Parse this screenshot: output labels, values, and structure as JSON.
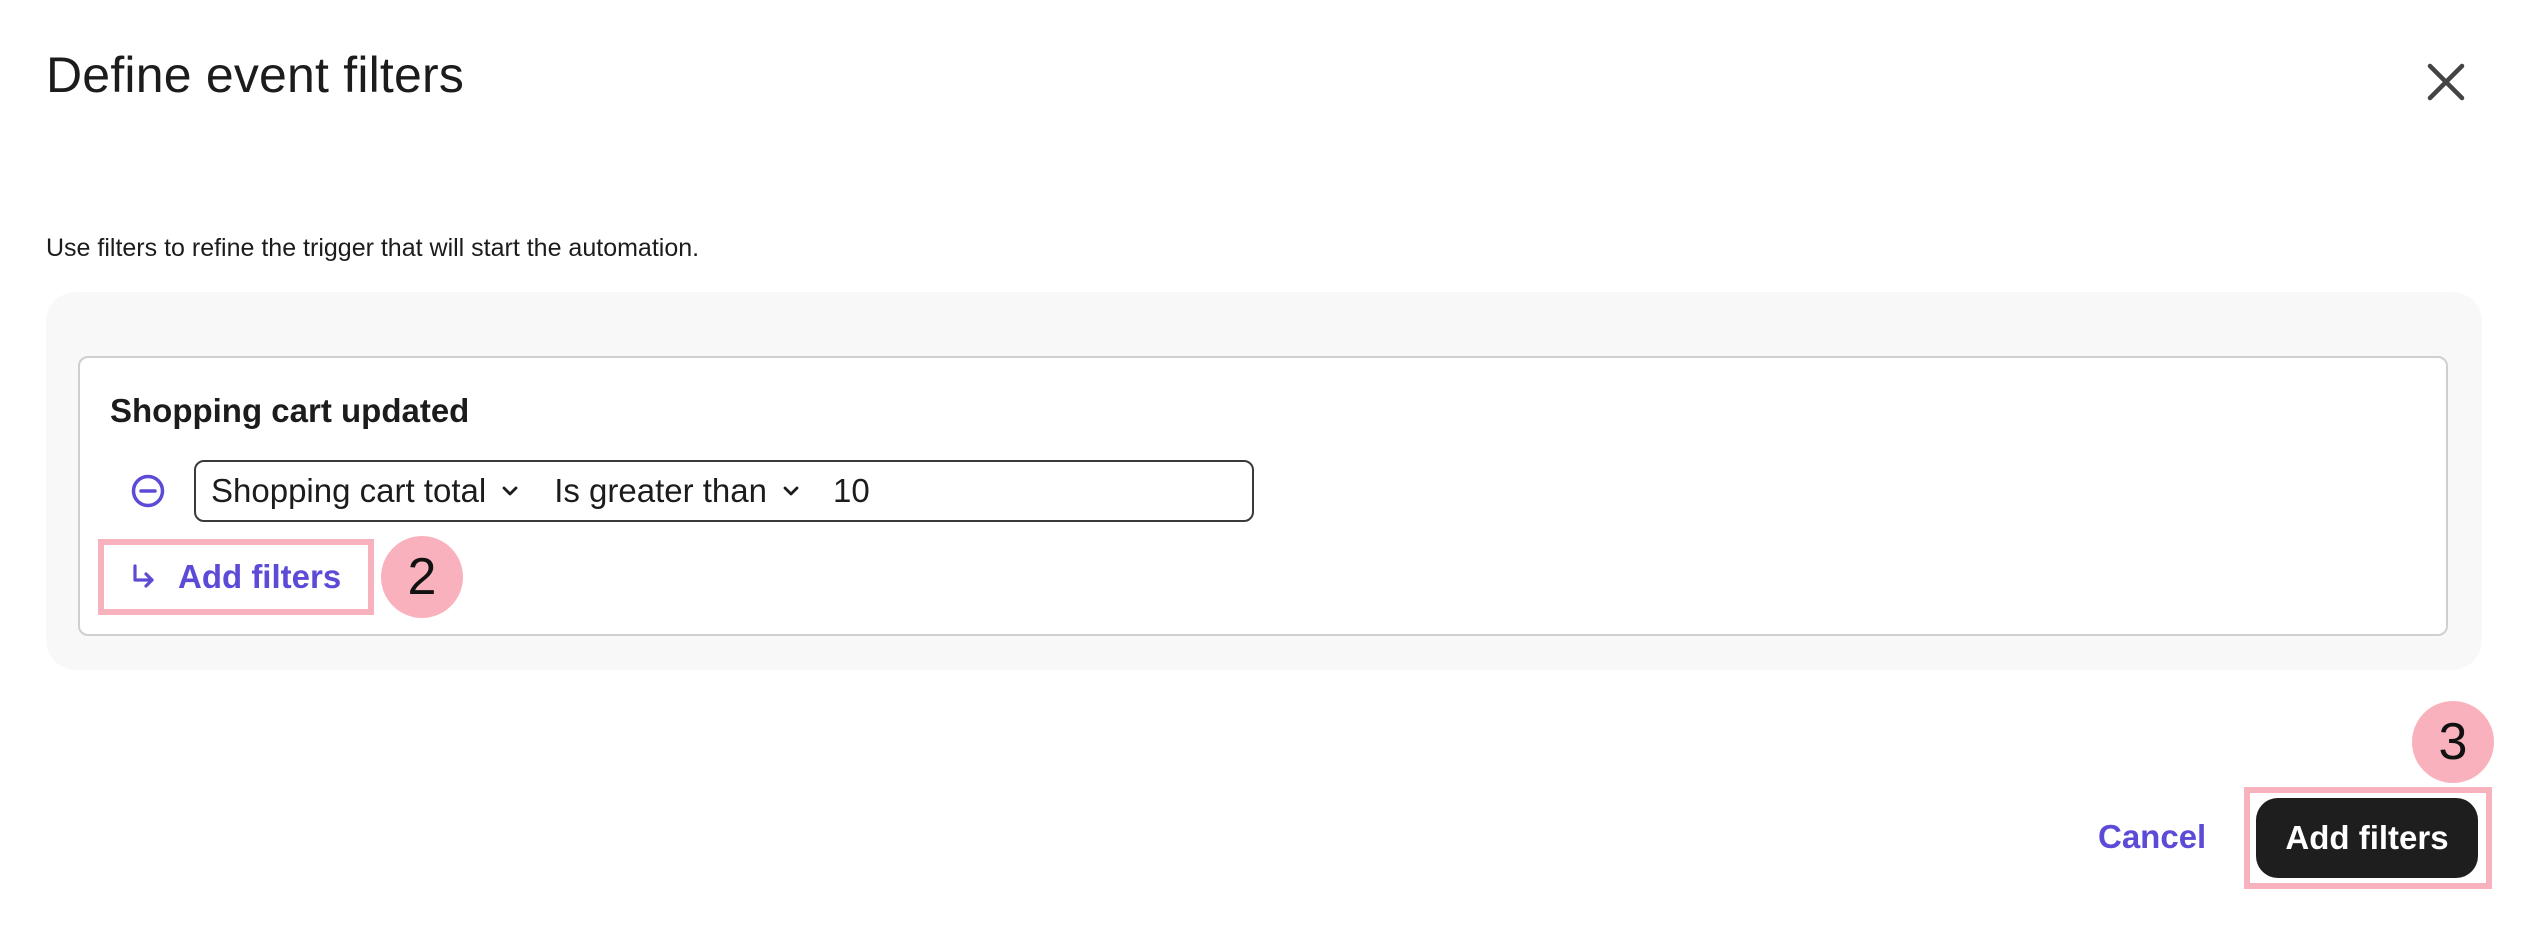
{
  "dialog": {
    "title": "Define event filters",
    "subtitle": "Use filters to refine the trigger that will start the automation."
  },
  "event_group": {
    "title": "Shopping cart updated",
    "filter": {
      "property": "Shopping cart total",
      "operator": "Is greater than",
      "value": "10"
    },
    "add_filters_label": "Add filters"
  },
  "callouts": {
    "step_2": "2",
    "step_3": "3"
  },
  "footer": {
    "cancel_label": "Cancel",
    "primary_label": "Add filters"
  },
  "colors": {
    "accent": "#5b4bd6",
    "primary_button": "#1e1e1e",
    "highlight": "#f7b2bd"
  },
  "icons": {
    "close": "close-icon",
    "remove": "minus-circle-icon",
    "chevron": "chevron-down-icon",
    "add": "arrow-turn-down-right-icon"
  }
}
